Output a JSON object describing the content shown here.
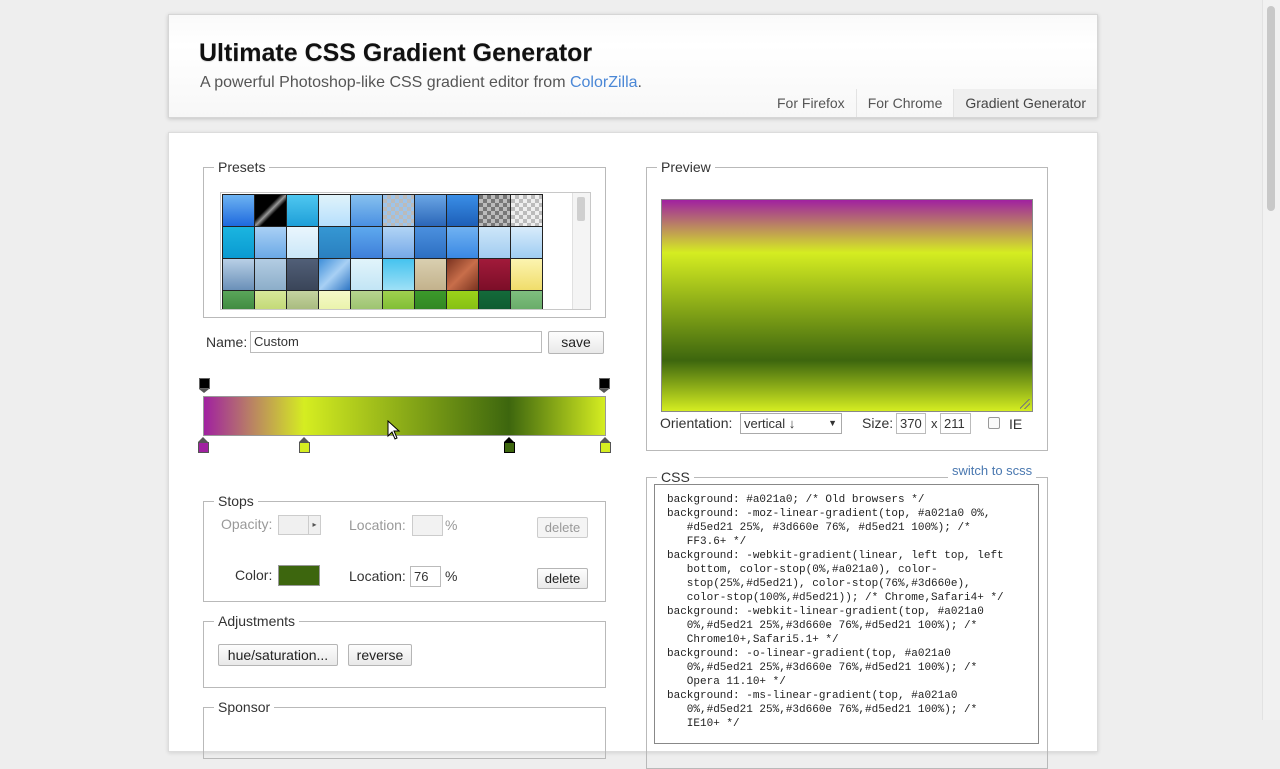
{
  "header": {
    "title": "Ultimate CSS Gradient Generator",
    "subtitle_prefix": "A powerful Photoshop-like CSS gradient editor from ",
    "subtitle_link": "ColorZilla",
    "subtitle_suffix": ".",
    "nav": [
      "For Firefox",
      "For Chrome",
      "Gradient Generator"
    ]
  },
  "presets": {
    "legend": "Presets",
    "swatches": [
      "linear-gradient(#6db3f2,#1e69de)",
      "linear-gradient(135deg,#000 40%,#999 50%,#000 60%)",
      "linear-gradient(#4fc7f0,#1e9fd8)",
      "linear-gradient(#e0f3fa,#b6dffd)",
      "linear-gradient(#87c1ef,#4a90e2)",
      "checker-blue",
      "linear-gradient(#6aa6e5,#2b66b8)",
      "linear-gradient(#3a8ee6,#1d5fb8)",
      "checker-dark",
      "checker",
      "linear-gradient(#1bb5e0,#0a9ad1)",
      "linear-gradient(#a9d0f5,#6ba9e6)",
      "linear-gradient(#eaf6fd,#cbe7f8)",
      "linear-gradient(#3597d3,#2a80c0)",
      "linear-gradient(#5ea9ee,#3f7fd9)",
      "linear-gradient(#b1d4f5,#76a9e8)",
      "linear-gradient(#4b90de,#2d6fc2)",
      "linear-gradient(#70b2f2,#3a88e3)",
      "linear-gradient(#cde6f9,#a2ccf0)",
      "linear-gradient(#d8ecfb,#9fcdf2)",
      "linear-gradient(#b8cfe6,#6a90b8)",
      "linear-gradient(#b3cde3,#8caec9)",
      "linear-gradient(#515f78,#3a4559)",
      "linear-gradient(135deg,#3d8ed9,#a8d0f4,#2f76c4)",
      "linear-gradient(#e1f4fb,#c3e5f5)",
      "linear-gradient(#45c3ef,#9ee0f6)",
      "linear-gradient(#d9cfb0,#c3b28c)",
      "linear-gradient(135deg,#7a3320,#c86e4a,#7a3320)",
      "linear-gradient(#a11a3a,#7c0e28)",
      "linear-gradient(#fcf4b0,#f0dd6b)",
      "linear-gradient(#5aa55a,#2f7a2f)",
      "linear-gradient(#d7e89a,#b5cf5f)",
      "linear-gradient(#c5d3a0,#95ab68)",
      "linear-gradient(#f5f9c9,#e3ef98)",
      "linear-gradient(#b7d48f,#8bb85a)",
      "linear-gradient(#9fd04f,#6cb222)",
      "linear-gradient(#3c9a2b,#2a7a1d)",
      "linear-gradient(#9bd21a,#78b510)",
      "linear-gradient(#146a3a,#0c5129)",
      "linear-gradient(#7fbe7f,#5aa05a)"
    ]
  },
  "name": {
    "label": "Name:",
    "value": "Custom",
    "save": "save"
  },
  "gradient": {
    "stops": [
      {
        "color": "#a021a0",
        "pos": 0
      },
      {
        "color": "#d5ed21",
        "pos": 25
      },
      {
        "color": "#3d660e",
        "pos": 76
      },
      {
        "color": "#d5ed21",
        "pos": 100
      }
    ]
  },
  "stops_panel": {
    "legend": "Stops",
    "opacity_label": "Opacity:",
    "location_label": "Location:",
    "percent": "%",
    "delete": "delete",
    "color_label": "Color:",
    "color_value": "#3d660e",
    "color_location": "76"
  },
  "adjustments": {
    "legend": "Adjustments",
    "hue": "hue/saturation...",
    "reverse": "reverse"
  },
  "sponsor": {
    "legend": "Sponsor"
  },
  "preview": {
    "legend": "Preview",
    "orientation_label": "Orientation:",
    "orientation_value": "vertical ↓",
    "size_label": "Size:",
    "width": "370",
    "height": "211",
    "x": "x",
    "ie_label": "IE"
  },
  "css": {
    "legend": "CSS",
    "switch": "switch to scss",
    "lines": [
      "background: #a021a0; /* Old browsers */",
      "background: -moz-linear-gradient(top, #a021a0 0%,",
      "   #d5ed21 25%, #3d660e 76%, #d5ed21 100%); /*",
      "   FF3.6+ */",
      "background: -webkit-gradient(linear, left top, left",
      "   bottom, color-stop(0%,#a021a0), color-",
      "   stop(25%,#d5ed21), color-stop(76%,#3d660e),",
      "   color-stop(100%,#d5ed21)); /* Chrome,Safari4+ */",
      "background: -webkit-linear-gradient(top, #a021a0",
      "   0%,#d5ed21 25%,#3d660e 76%,#d5ed21 100%); /*",
      "   Chrome10+,Safari5.1+ */",
      "background: -o-linear-gradient(top, #a021a0",
      "   0%,#d5ed21 25%,#3d660e 76%,#d5ed21 100%); /*",
      "   Opera 11.10+ */",
      "background: -ms-linear-gradient(top, #a021a0",
      "   0%,#d5ed21 25%,#3d660e 76%,#d5ed21 100%); /*",
      "   IE10+ */"
    ]
  }
}
